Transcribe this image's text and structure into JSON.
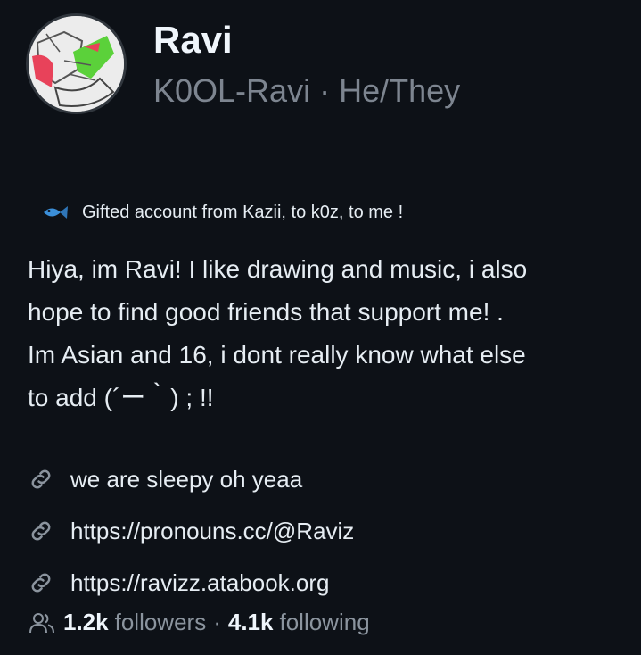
{
  "profile": {
    "name": "Ravi",
    "username": "K0OL-Ravi",
    "separator": "·",
    "pronouns": "He/They"
  },
  "status": {
    "emoji_icon": "fish-icon",
    "text": "Gifted account from Kazii, to k0z, to me !"
  },
  "bio": {
    "line1": "Hiya, im Ravi! I like drawing and music, i also",
    "line2": "hope to find good friends that support me! .",
    "line3": "Im Asian and 16, i dont really know what else",
    "line4": "to add (´ー｀) ; !!"
  },
  "links": [
    {
      "icon": "link-icon",
      "text": "we are sleepy oh yeaa"
    },
    {
      "icon": "link-icon",
      "text": "https://pronouns.cc/@Raviz"
    },
    {
      "icon": "link-icon",
      "text": "https://ravizz.atabook.org"
    }
  ],
  "stats": {
    "icon": "people-icon",
    "followers_count": "1.2k",
    "followers_label": "followers",
    "separator": "·",
    "following_count": "4.1k",
    "following_label": "following"
  },
  "colors": {
    "background": "#0d1117",
    "text": "#e6edf3",
    "muted": "#7d8590"
  }
}
